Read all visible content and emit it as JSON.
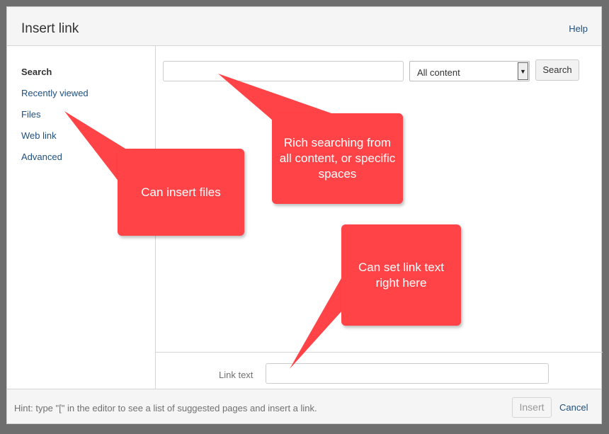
{
  "dialog": {
    "title": "Insert link",
    "help": "Help"
  },
  "sidebar": {
    "items": [
      {
        "label": "Search",
        "active": true
      },
      {
        "label": "Recently viewed"
      },
      {
        "label": "Files"
      },
      {
        "label": "Web link"
      },
      {
        "label": "Advanced"
      }
    ]
  },
  "search": {
    "query": "",
    "scope_selected": "All content",
    "button": "Search"
  },
  "link_text": {
    "label": "Link text",
    "value": ""
  },
  "footer": {
    "hint": "Hint: type \"[\" in the editor to see a list of suggested pages and insert a link.",
    "insert": "Insert",
    "cancel": "Cancel"
  },
  "callouts": {
    "search": "Rich searching from all content, or specific spaces",
    "files": "Can insert files",
    "link_text": "Can set link text right here"
  },
  "colors": {
    "link": "#205081",
    "callout": "#ff4347"
  }
}
